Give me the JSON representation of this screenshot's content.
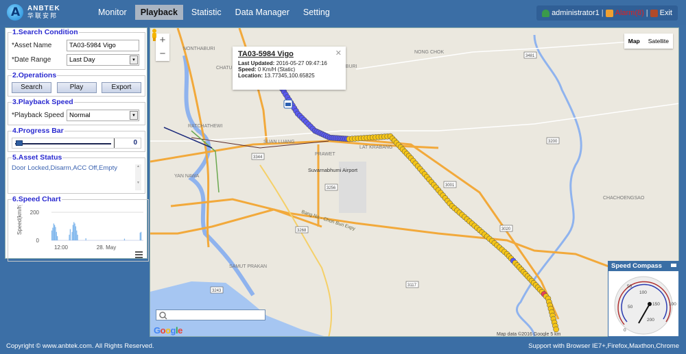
{
  "header": {
    "logo_en": "ANBTEK",
    "logo_cn": "华联安邦",
    "nav": [
      {
        "label": "Monitor",
        "active": false
      },
      {
        "label": "Playback",
        "active": true
      },
      {
        "label": "Statistic",
        "active": false
      },
      {
        "label": "Data Manager",
        "active": false
      },
      {
        "label": "Setting",
        "active": false
      }
    ],
    "user": "administrator1",
    "alarm": "Alarm(8)",
    "exit": "Exit"
  },
  "panel": {
    "search": {
      "legend": "1.Search Condition",
      "asset_label": "*Asset Name",
      "asset_value": "TA03-5984 Vigo",
      "date_label": "*Date Range",
      "date_value": "Last Day"
    },
    "operations": {
      "legend": "2.Operations",
      "search": "Search",
      "play": "Play",
      "export": "Export"
    },
    "speed": {
      "legend": "3.Playback Speed",
      "label": "*Playback Speed",
      "value": "Normal"
    },
    "progress": {
      "legend": "4.Progress Bar",
      "value": "0",
      "fraction": 0
    },
    "status": {
      "legend": "5.Asset Status",
      "text": "Door Locked,Disarm,ACC Off,Empty"
    },
    "chart": {
      "legend": "6.Speed Chart"
    }
  },
  "chart_data": {
    "type": "area",
    "title": "",
    "ylabel": "Speed(km/h)",
    "xlabel": "",
    "ylim": [
      0,
      200
    ],
    "yticks": [
      "0",
      "200"
    ],
    "xticks": [
      "12:00",
      "28. May"
    ],
    "series": [
      {
        "name": "Speed",
        "x": [
          0,
          1,
          2,
          3,
          4,
          5,
          6,
          7,
          8,
          9,
          10,
          11,
          12,
          13,
          14,
          15,
          16,
          17,
          18,
          19,
          20,
          21,
          22,
          23,
          24,
          25,
          26,
          27,
          28,
          29,
          30,
          31,
          32,
          33,
          34,
          35,
          36,
          37,
          38,
          39,
          40,
          41,
          42,
          43,
          44,
          45,
          46,
          47,
          48,
          49,
          50,
          51,
          52,
          53,
          54,
          55,
          56,
          57,
          58,
          59,
          60,
          61,
          62,
          63,
          64,
          65,
          66,
          67,
          68,
          69,
          70,
          71,
          72,
          73,
          74,
          75,
          76,
          77,
          78,
          79,
          80,
          81,
          82,
          83,
          84,
          85,
          86,
          87,
          88,
          89,
          90,
          91,
          92,
          93,
          94,
          95,
          96,
          97,
          98,
          99
        ],
        "values": [
          70,
          90,
          120,
          110,
          95,
          60,
          30,
          0,
          0,
          0,
          0,
          0,
          0,
          0,
          0,
          0,
          0,
          0,
          0,
          40,
          80,
          0,
          60,
          110,
          130,
          120,
          100,
          70,
          40,
          0,
          0,
          0,
          0,
          0,
          0,
          0,
          0,
          15,
          0,
          0,
          0,
          0,
          0,
          0,
          0,
          0,
          0,
          0,
          0,
          0,
          0,
          0,
          0,
          0,
          0,
          0,
          0,
          0,
          0,
          0,
          0,
          0,
          0,
          0,
          0,
          0,
          0,
          0,
          0,
          0,
          0,
          0,
          0,
          0,
          0,
          0,
          0,
          0,
          0,
          12,
          0,
          0,
          0,
          0,
          0,
          0,
          0,
          0,
          0,
          0,
          0,
          0,
          0,
          0,
          0,
          0,
          55,
          60,
          0,
          0
        ]
      }
    ]
  },
  "map": {
    "zoom_in": "+",
    "zoom_out": "−",
    "type_map": "Map",
    "type_satellite": "Satellite",
    "info": {
      "title": "TA03-5984 Vigo",
      "updated_label": "Last Updated:",
      "updated": "2016-05-27 09:47:16",
      "speed_label": "Speed:",
      "speed": "0 Km/H (Static)",
      "location_label": "Location:",
      "location": "13.77345,100.65825"
    },
    "labels": [
      "NONTHABURI",
      "CHATUCHAK",
      "RATCHATHEWI",
      "SUAN LUANG",
      "PRAWET",
      "LAT KRABANG",
      "MIN BURI",
      "NONG CHOK",
      "YAN NAWA",
      "SAMUT PRAKAN",
      "CHACHOENGSAO",
      "Suvarnabhumi Airport",
      "Bang Na - Chon Buri Expy"
    ],
    "search_placeholder": "",
    "google": "Google",
    "attribution": "Map data ©2016 Google   5 km"
  },
  "compass": {
    "title": "Speed Compass",
    "ticks": [
      "0",
      "50",
      "100",
      "150",
      "200"
    ],
    "outer": [
      "50",
      "100"
    ],
    "speed": 0
  },
  "footer": {
    "copyright": "Copyright © www.anbtek.com. All Rights Reserved.",
    "support": "Support with Browser IE7+,Firefox,Maxthon,Chrome"
  }
}
